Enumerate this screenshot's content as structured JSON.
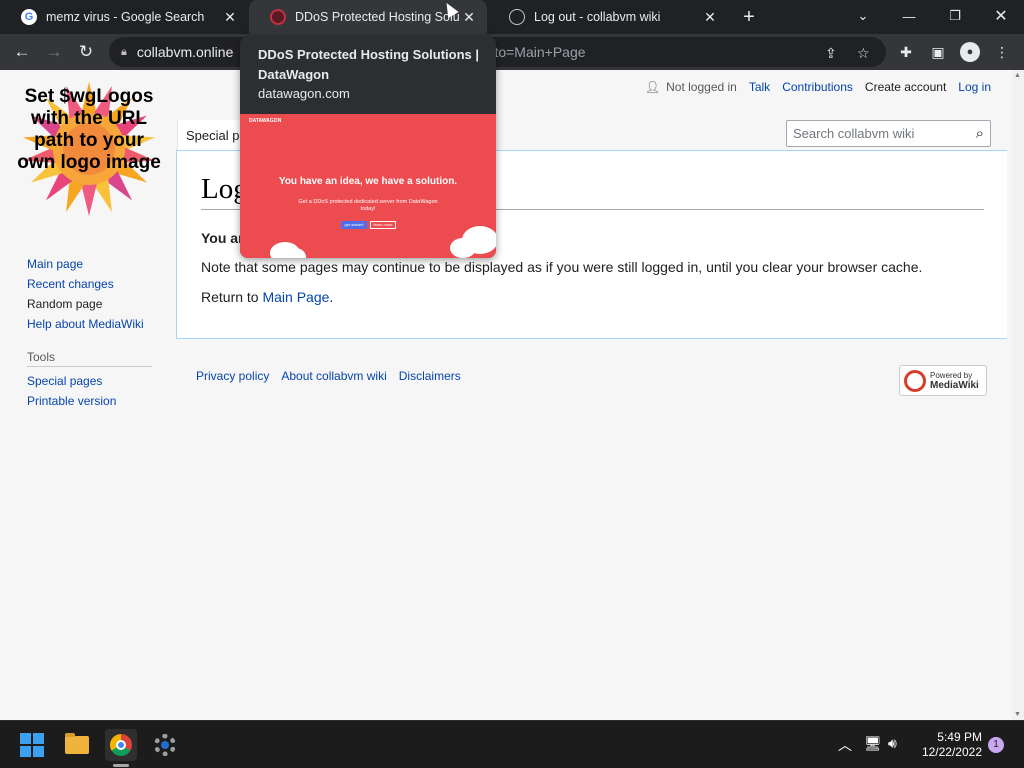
{
  "browser": {
    "tabs": [
      {
        "title": "memz virus - Google Search",
        "favicon": "google-icon"
      },
      {
        "title": "DDoS Protected Hosting Solutio",
        "favicon": "datawagon-icon"
      },
      {
        "title": "Log out - collabvm wiki",
        "favicon": "globe-icon"
      }
    ],
    "url_visible": "collabvm.online",
    "url_tail": "rnto=Main+Page"
  },
  "hovercard": {
    "title": "DDoS Protected Hosting Solutions | DataWagon",
    "domain": "datawagon.com",
    "preview": {
      "brand": "DATAWAGON",
      "headline": "You have an idea, we have a solution.",
      "subline": "Get a DDoS protected dedicated server from DataWagon today!",
      "button_primary": "get started",
      "button_secondary": "learn more",
      "bg_color": "#ec4b4f"
    }
  },
  "wiki": {
    "logo_text": "Set $wgLogos with the URL path to your own logo image",
    "personal": {
      "status": "Not logged in",
      "talk": "Talk",
      "contributions": "Contributions",
      "create_account": "Create account",
      "login": "Log in"
    },
    "special_tab": "Special p",
    "search_placeholder": "Search collabvm wiki",
    "heading": "Log",
    "bold_partial": "You ar",
    "note": "Note that some pages may continue to be displayed as if you were still logged in, until you clear your browser cache.",
    "return_prefix": "Return to ",
    "return_link": "Main Page",
    "return_suffix": ".",
    "nav": [
      "Main page",
      "Recent changes",
      "Random page",
      "Help about MediaWiki"
    ],
    "tools_heading": "Tools",
    "tools": [
      "Special pages",
      "Printable version"
    ],
    "footer": [
      "Privacy policy",
      "About collabvm wiki",
      "Disclaimers"
    ],
    "powered_by_line1": "Powered by",
    "powered_by_line2": "MediaWiki"
  },
  "taskbar": {
    "time": "5:49 PM",
    "date": "12/22/2022",
    "notification_count": "1"
  }
}
